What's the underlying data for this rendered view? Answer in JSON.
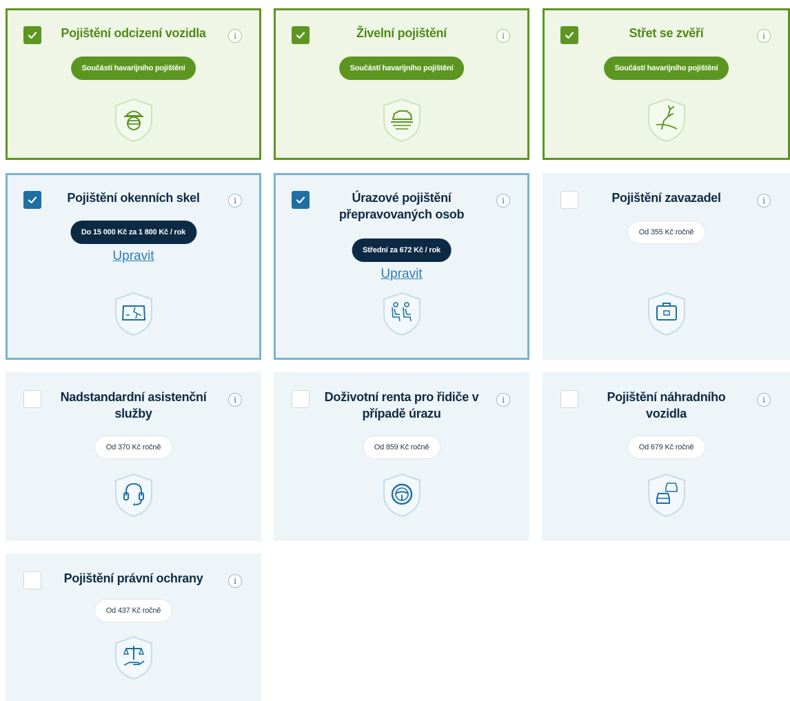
{
  "info_glyph": "i",
  "colors": {
    "green_accent": "#5c9621",
    "blue_accent": "#1d6fa5",
    "navy_pill": "#0d2a45",
    "link": "#2a7cb8"
  },
  "cards": [
    {
      "title": "Pojištění odcizení vozidla",
      "checked": true,
      "style": "green",
      "badge": "Součástí havarijního pojištění",
      "icon": "thief-icon"
    },
    {
      "title": "Živelní pojištění",
      "checked": true,
      "style": "green",
      "badge": "Součástí havarijního pojištění",
      "icon": "flood-car-icon"
    },
    {
      "title": "Střet se zvěří",
      "checked": true,
      "style": "green",
      "badge": "Součástí havarijního pojištění",
      "icon": "deer-icon"
    },
    {
      "title": "Pojištění okenních skel",
      "checked": true,
      "style": "blue",
      "badge": "Do 15 000 Kč za 1 800 Kč / rok",
      "link": "Upravit",
      "icon": "broken-glass-icon"
    },
    {
      "title": "Úrazové pojištění přepravovaných osob",
      "checked": true,
      "style": "blue",
      "badge": "Střední za 672 Kč / rok",
      "link": "Upravit",
      "icon": "passengers-icon"
    },
    {
      "title": "Pojištění zavazadel",
      "checked": false,
      "style": "plain",
      "badge": "Od 355 Kč ročně",
      "icon": "luggage-icon"
    },
    {
      "title": "Nadstandardní asistenční služby",
      "checked": false,
      "style": "plain",
      "badge": "Od 370 Kč ročně",
      "icon": "headset-icon"
    },
    {
      "title": "Doživotní renta pro řidiče v případě úrazu",
      "checked": false,
      "style": "plain",
      "badge": "Od 859 Kč ročně",
      "icon": "steering-wheel-icon"
    },
    {
      "title": "Pojištění náhradního vozidla",
      "checked": false,
      "style": "plain",
      "badge": "Od 679 Kč ročně",
      "icon": "replacement-car-icon"
    },
    {
      "title": "Pojištění právní ochrany",
      "checked": false,
      "style": "plain",
      "badge": "Od 437 Kč ročně",
      "icon": "scales-icon"
    }
  ]
}
